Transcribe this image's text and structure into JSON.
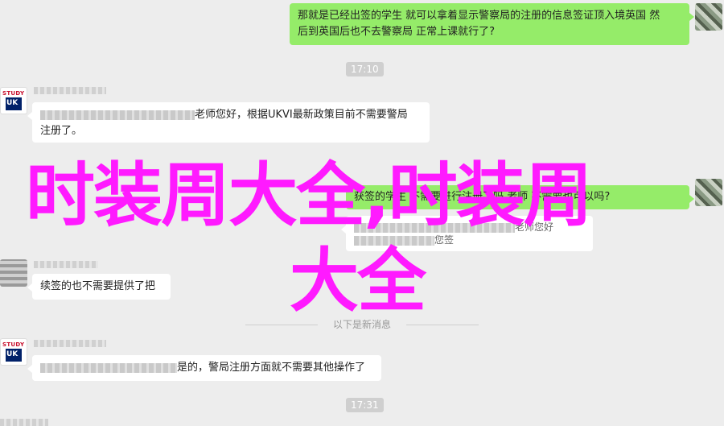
{
  "messages": {
    "m1_line1": "那就是已经出签的学生 就可以拿着显示警察局的注册的信息签证顶入境英国 然",
    "m1_line2": "后到英国后也不去警察局 正常上课就行了?",
    "m2_line1": "老师您好，根据UKVI最新政策目前不需要警局",
    "m2_line2": "注册了。",
    "m3_visible": "获签的学生 不需要进行注册了吗 老师 不需要也可以吗?",
    "m4_line": "老师您好",
    "m4_sub": "您签",
    "m5": "续签的也不需要提供了把",
    "m6": "是的，警局注册方面就不需要其他操作了"
  },
  "timestamps": {
    "t1": "17:10",
    "t2": "17:31"
  },
  "divider": {
    "text": "以下是新消息"
  },
  "avatars": {
    "study_label": "STUDY"
  },
  "overlay": {
    "line1": "时装周大全,时装周",
    "line2": "大全",
    "color": "#ff1aff"
  },
  "colors": {
    "self_bubble": "#95ec69",
    "other_bubble": "#ffffff",
    "background": "#ededed"
  }
}
